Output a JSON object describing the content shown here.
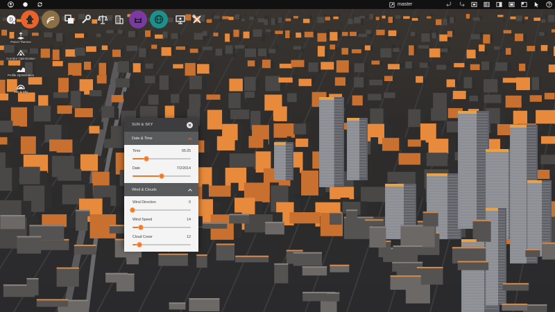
{
  "topbar": {
    "branch": "master"
  },
  "toolbar": {
    "items": [
      {
        "icon": "dashboard-icon",
        "color": "#ffffff"
      },
      {
        "icon": "fire-hydrant-icon",
        "color": "#e8622a"
      },
      {
        "icon": "pipeline-icon",
        "color": "#8a6f47"
      },
      {
        "icon": "layers-icon",
        "color": "#ffffff"
      },
      {
        "icon": "wrench-icon",
        "color": "#ffffff"
      },
      {
        "icon": "scales-icon",
        "color": "#ffffff"
      },
      {
        "icon": "building-icon",
        "color": "#ffffff"
      },
      {
        "icon": "cat-icon",
        "color": "#7a3aa0"
      },
      {
        "icon": "globe-icon",
        "color": "#1e8f8a"
      },
      {
        "icon": "presentation-icon",
        "color": "#ffffff"
      },
      {
        "icon": "tools-icon",
        "color": "#ffffff"
      }
    ]
  },
  "side_tools": {
    "items": [
      {
        "label": "Parcel Themes"
      },
      {
        "label": "Corridor Optimization"
      },
      {
        "label": "Profile Optimization"
      },
      {
        "label": "Sun & Sky"
      }
    ]
  },
  "panel": {
    "title": "SUN & SKY",
    "sections": [
      {
        "title": "Date & Time",
        "props": [
          {
            "label": "Time",
            "value": "05:25",
            "level": 0.24
          },
          {
            "label": "Date",
            "value": "7/2/2014",
            "level": 0.5
          }
        ]
      },
      {
        "title": "Wind & Clouds",
        "props": [
          {
            "label": "Wind Direction",
            "value": "0",
            "level": 0.0
          },
          {
            "label": "Wind Speed",
            "value": "14",
            "level": 0.14
          },
          {
            "label": "Cloud Cover",
            "value": "12",
            "level": 0.12
          }
        ]
      }
    ]
  }
}
